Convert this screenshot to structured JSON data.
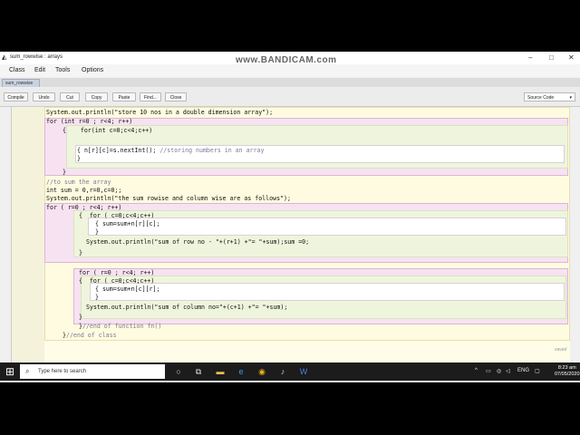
{
  "window": {
    "title": "sum_rowwise : arrays",
    "watermark": "www.BANDICAM.com",
    "controls": {
      "minimize": "–",
      "maximize": "□",
      "close": "✕"
    }
  },
  "menu": [
    "Class",
    "Edit",
    "Tools",
    "Options"
  ],
  "tab": {
    "label": "sum_rowwise"
  },
  "toolbar": {
    "buttons": [
      "Compile",
      "Undo",
      "Cut",
      "Copy",
      "Paste",
      "Find...",
      "Close"
    ],
    "view_select": "Source Code"
  },
  "code_lines": [
    "System.out.println(\"store 10 nos in a double dimension array\");",
    "for (int r=0 ; r<4; r++)",
    "{    for(int c=0;c<4;c++)",
    "{ n[r][c]=s.nextInt(); ",
    "//storing numbers in an array",
    "}",
    "}",
    "//to sum the array",
    "int sum = 0,r=0,c=0;;",
    "System.out.println(\"the sum rowise and column wise are as follows\");",
    "for ( r=0 ; r<4; r++)",
    "{  for ( c=0;c<4;c++)",
    "{ sum=sum+n[r][c];",
    "}",
    "System.out.println(\"sum of row no - \"+(r+1) +\"= \"+sum);sum =0;",
    "}",
    "for ( r=0 ; r<4; r++)",
    "{  for ( c=0;c<4;c++)",
    "{ sum=sum+n[c][r];",
    "}",
    "System.out.println(\"sum of column no=\"+(c+1) +\"= \"+sum);",
    "}",
    "}",
    "//end of function fn()",
    "}",
    "//end of class"
  ],
  "status": {
    "saved": "saved"
  },
  "taskbar": {
    "search_placeholder": "Type here to search",
    "language": "ENG",
    "time": "8:23 am",
    "date": "07/05/2020"
  }
}
